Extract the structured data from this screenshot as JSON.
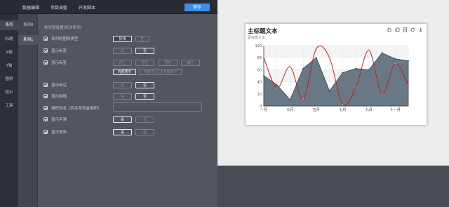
{
  "topbar": {
    "tabs": [
      "数据编辑",
      "参数调整",
      "开发脚本"
    ],
    "save_label": "保存"
  },
  "leftnav": {
    "items": [
      "系列",
      "标题",
      "X轴",
      "Y轴",
      "图例",
      "提示",
      "工具"
    ],
    "active": 0
  },
  "series_list": {
    "items": [
      "系列0",
      "系列1"
    ],
    "active": 1
  },
  "panel": {
    "heading": "柱状图设置(针对系列)",
    "rows": [
      {
        "label": "系列的图形类型",
        "options": [
          "折线",
          "柱"
        ],
        "selected": 0
      },
      {
        "label": "显示标签",
        "options": [
          "是",
          "否"
        ],
        "selected": 1
      },
      {
        "label": "显示标签",
        "options": [
          "顶上",
          "居左",
          "居右",
          "底下",
          "内部居中",
          "内部顶上",
          "内部底下"
        ],
        "selected": 4
      },
      {
        "label": "显示标注",
        "options": [
          "是",
          "否"
        ],
        "selected": 1
      },
      {
        "label": "显示标线",
        "options": [
          "是",
          "否"
        ],
        "selected": 1
      },
      {
        "label": "堆积命名（同名系列会堆积）",
        "input_value": ""
      },
      {
        "label": "显示平滑",
        "options": [
          "是",
          "否"
        ],
        "selected": 0
      },
      {
        "label": "显示填充",
        "options": [
          "是",
          "否"
        ],
        "selected": 0
      }
    ]
  },
  "chart_card": {
    "title": "主标题文本",
    "subtitle": "副标题文本",
    "toolbox_icons": [
      "restore-icon",
      "data-view-icon",
      "document-icon",
      "refresh-icon",
      "download-icon"
    ]
  },
  "chart_data": {
    "type": "line",
    "categories": [
      "一月",
      "二月",
      "三月",
      "四月",
      "五月",
      "六月",
      "七月",
      "八月",
      "九月",
      "十月",
      "十一月",
      "十二月"
    ],
    "tick_labels": [
      "一月",
      "三月",
      "五月",
      "七月",
      "九月",
      "十一月"
    ],
    "ylim": [
      0,
      100
    ],
    "yticks": [
      0,
      20,
      40,
      60,
      80,
      100
    ],
    "series": [
      {
        "type": "area",
        "smooth": false,
        "color": "#5d6e7c",
        "values": [
          50,
          35,
          10,
          62,
          80,
          25,
          55,
          62,
          60,
          88,
          78,
          75
        ]
      },
      {
        "type": "line",
        "smooth": true,
        "color": "#b22222",
        "values": [
          80,
          30,
          65,
          12,
          95,
          80,
          3,
          30,
          92,
          20,
          70,
          35
        ]
      }
    ]
  }
}
